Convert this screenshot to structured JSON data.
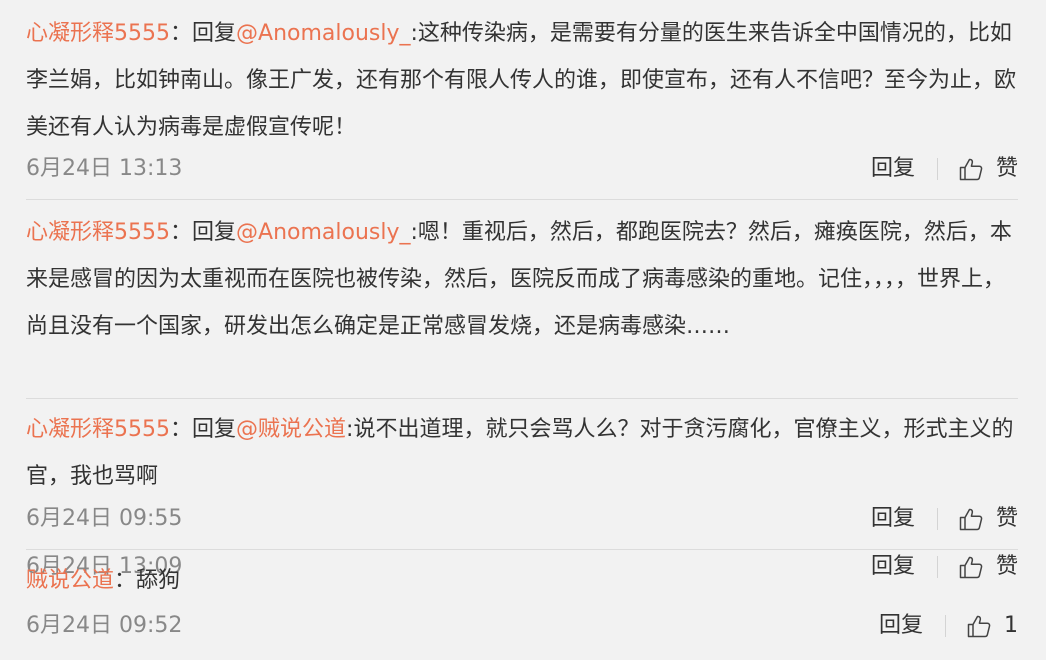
{
  "comments": [
    {
      "author": "心凝形释5555",
      "colon": "：",
      "reply_prefix": "回复",
      "mention": "@Anomalously_",
      "text": ":这种传染病，是需要有分量的医生来告诉全中国情况的，比如李兰娟，比如钟南山。像王广发，还有那个有限人传人的谁，即使宣布，还有人不信吧？至今为止，欧美还有人认为病毒是虚假宣传呢！",
      "time": "6月24日 13:13",
      "reply_label": "回复",
      "like_label": "赞",
      "like_icon": "thumbs-up-icon"
    },
    {
      "author": "心凝形释5555",
      "colon": "：",
      "reply_prefix": "回复",
      "mention": "@Anomalously_",
      "text": ":嗯！重视后，然后，都跑医院去？然后，瘫痪医院，然后，本来是感冒的因为太重视而在医院也被传染，然后，医院反而成了病毒感染的重地。记住，，，，世界上，尚且没有一个国家，研发出怎么确定是正常感冒发烧，还是病毒感染……",
      "time": "6月24日 13:09",
      "reply_label": "回复",
      "like_label": "赞",
      "like_icon": "thumbs-up-icon"
    },
    {
      "author": "心凝形释5555",
      "colon": "：",
      "reply_prefix": "回复",
      "mention": "@贼说公道",
      "text": ":说不出道理，就只会骂人么？对于贪污腐化，官僚主义，形式主义的官，我也骂啊",
      "time": "6月24日 09:55",
      "reply_label": "回复",
      "like_label": "赞",
      "like_icon": "thumbs-up-icon"
    },
    {
      "author": "贼说公道",
      "colon": "：",
      "text": "舔狗",
      "time": "6月24日 09:52",
      "reply_label": "回复",
      "like_label": "1",
      "like_icon": "thumbs-up-icon"
    }
  ],
  "colors": {
    "author": "#eb7350",
    "text": "#333333",
    "time": "#888888",
    "background": "#f2f2f2",
    "divider": "#dcdcdc"
  }
}
